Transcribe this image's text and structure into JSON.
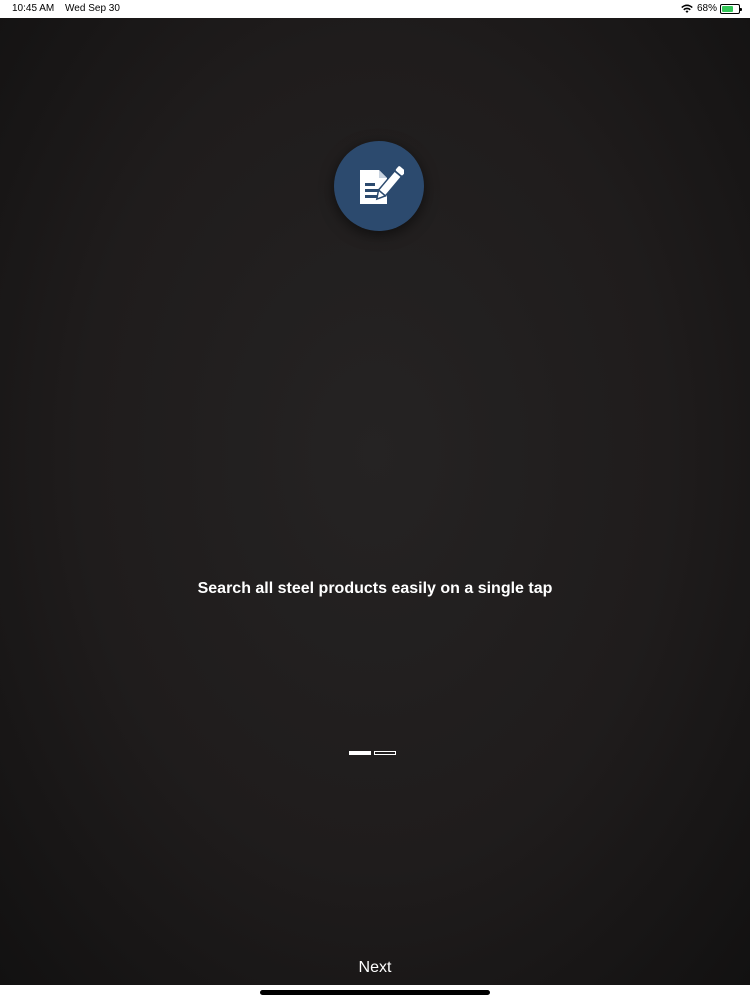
{
  "status_bar": {
    "time": "10:45 AM",
    "date": "Wed Sep 30",
    "battery_percent": "68%",
    "battery_level": 0.68,
    "wifi_icon": "wifi-icon",
    "battery_icon": "battery-charging-icon"
  },
  "onboarding": {
    "icon": "document-edit-icon",
    "icon_color": "#2c4a6e",
    "tagline": "Search all steel products easily on a single tap",
    "page_count": 2,
    "current_page": 1
  },
  "footer": {
    "next_label": "Next"
  }
}
